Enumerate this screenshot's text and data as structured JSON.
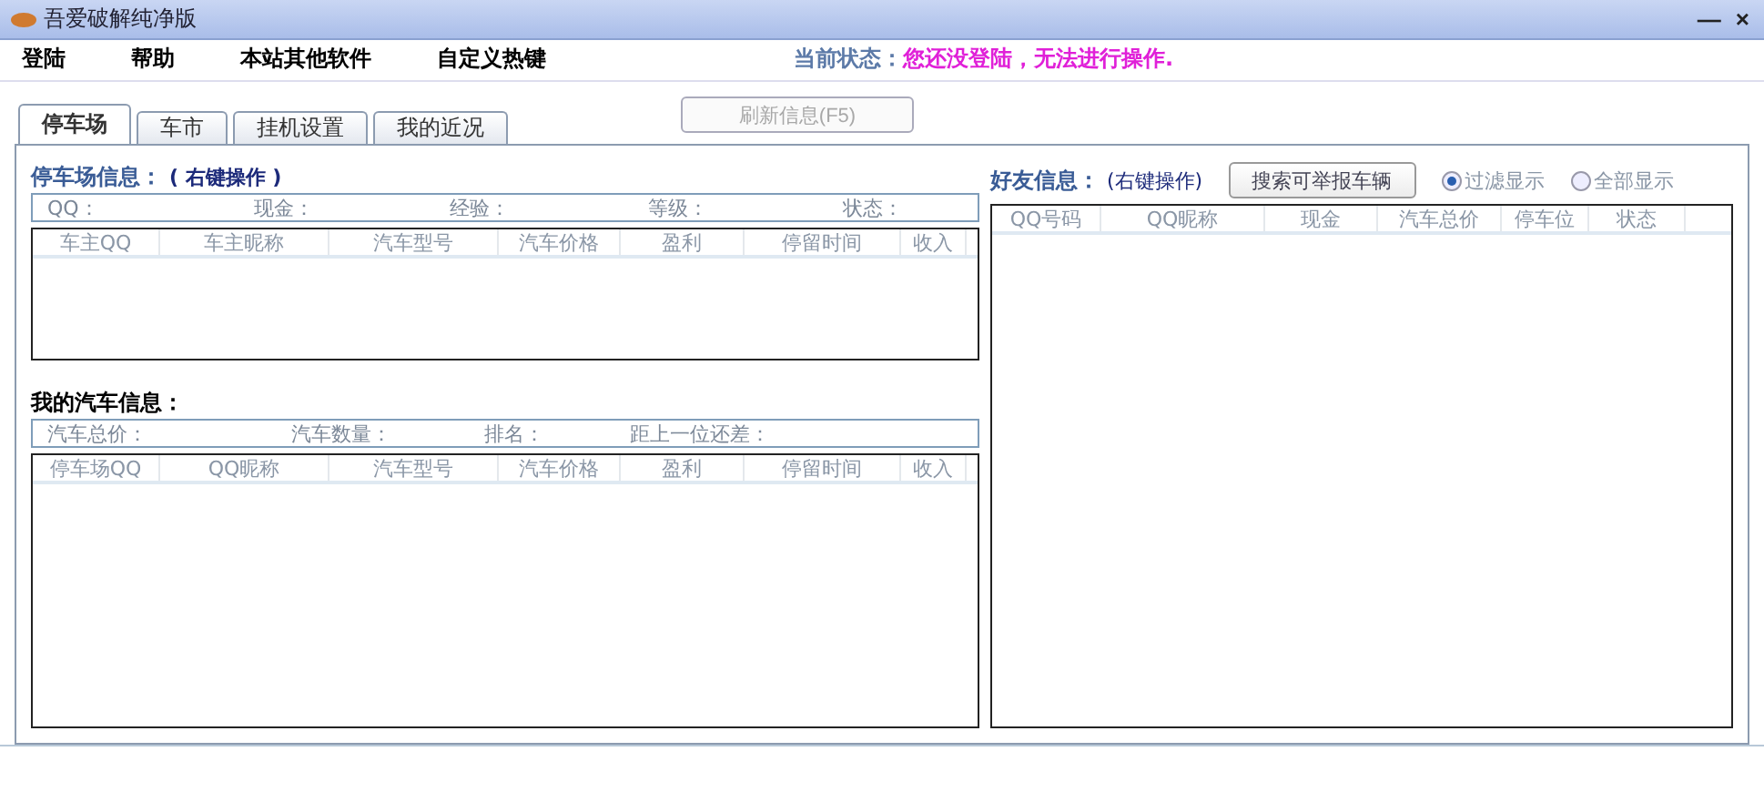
{
  "window": {
    "title": "吾爱破解纯净版",
    "controls": [
      "—",
      "×"
    ]
  },
  "menu": [
    "登陆",
    "帮助",
    "本站其他软件",
    "自定义热键"
  ],
  "status": {
    "label": "当前状态：",
    "message": "您还没登陆，无法进行操作."
  },
  "tabs": [
    {
      "label": "停车场",
      "selected": true
    },
    {
      "label": "车市",
      "selected": false
    },
    {
      "label": "挂机设置",
      "selected": false
    },
    {
      "label": "我的近况",
      "selected": false
    }
  ],
  "refresh_button": {
    "label": "刷新信息(F5)",
    "disabled": true
  },
  "parking": {
    "title": "停车场信息：",
    "hint": "( 右键操作 )",
    "info": [
      "QQ：",
      "现金：",
      "经验：",
      "等级：",
      "状态："
    ],
    "columns": [
      "车主QQ",
      "车主昵称",
      "汽车型号",
      "汽车价格",
      "盈利",
      "停留时间",
      "收入"
    ]
  },
  "my_cars": {
    "title": "我的汽车信息：",
    "info": [
      "汽车总价：",
      "汽车数量：",
      "排名：",
      "距上一位还差："
    ],
    "columns": [
      "停车场QQ",
      "QQ昵称",
      "汽车型号",
      "汽车价格",
      "盈利",
      "停留时间",
      "收入"
    ]
  },
  "friends": {
    "title": "好友信息：",
    "hint": "(右键操作)",
    "search_button": "搜索可举报车辆",
    "filters": [
      {
        "label": "过滤显示",
        "selected": true
      },
      {
        "label": "全部显示",
        "selected": false
      }
    ],
    "columns": [
      "QQ号码",
      "QQ昵称",
      "现金",
      "汽车总价",
      "停车位",
      "状态"
    ]
  }
}
